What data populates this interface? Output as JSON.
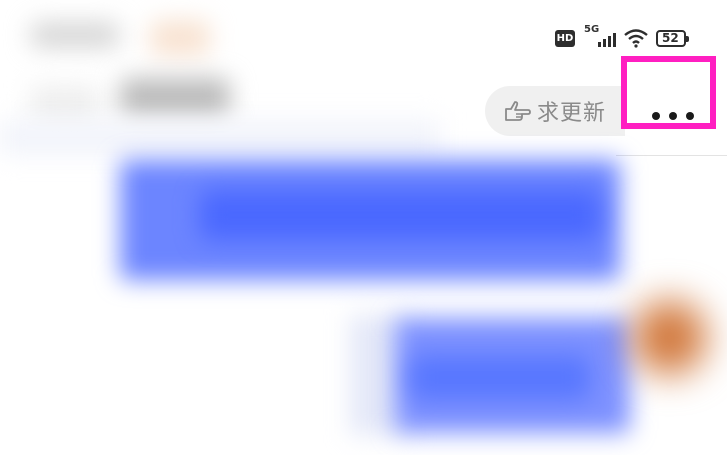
{
  "status_bar": {
    "hd_badge": "HD",
    "network_type": "5G",
    "battery_level": "52"
  },
  "header": {
    "request_update_label": "求更新",
    "more_button_label": "..."
  },
  "colors": {
    "highlight_box": "#ff1fc1",
    "pill_background": "#f0f0f0",
    "content_blue": "#5877ff"
  },
  "icons": [
    "hand-pointing-icon",
    "more-dots-icon",
    "wifi-icon",
    "signal-icon",
    "battery-icon"
  ]
}
